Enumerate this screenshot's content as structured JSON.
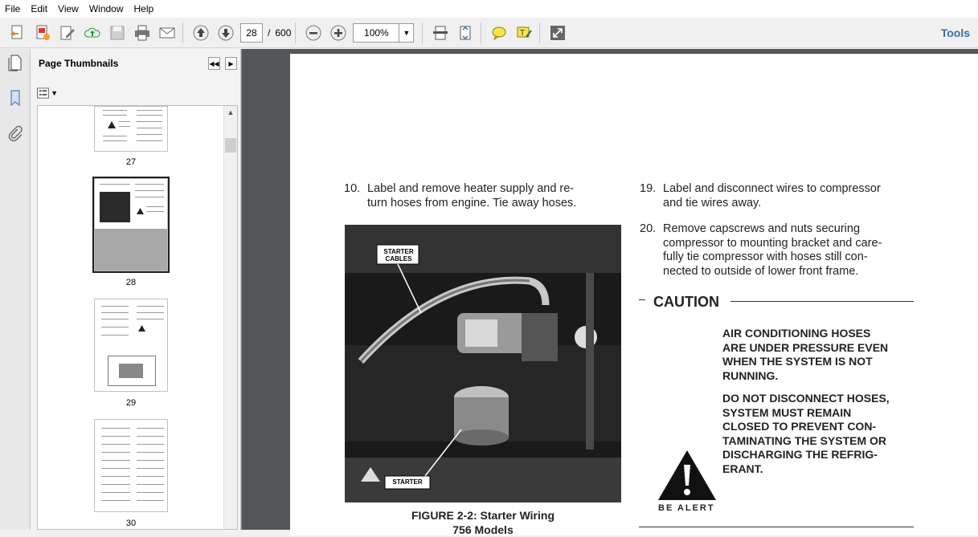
{
  "menu": [
    "File",
    "Edit",
    "View",
    "Window",
    "Help"
  ],
  "toolbar": {
    "current_page": "28",
    "page_separator": "/",
    "total_pages": "600",
    "zoom": "100%",
    "tools_label": "Tools"
  },
  "panel": {
    "title": "Page Thumbnails",
    "thumbnails": [
      {
        "label": "27"
      },
      {
        "label": "28"
      },
      {
        "label": "29"
      },
      {
        "label": "30"
      }
    ]
  },
  "document": {
    "item10_num": "10.",
    "item10_lines": [
      "Label and remove heater supply and re-",
      "turn hoses from engine.  Tie away hoses."
    ],
    "item19_num": "19.",
    "item19_lines": [
      "Label and disconnect wires to compressor",
      "and tie wires away."
    ],
    "item20_num": "20.",
    "item20_lines": [
      "Remove  capscrews  and  nuts  securing",
      "compressor to mounting bracket and care-",
      "fully tie compressor with hoses still con-",
      "nected to outside of lower front frame."
    ],
    "photo_label_1": [
      "STARTER",
      "CABLES"
    ],
    "photo_label_2": "STARTER",
    "figure_caption": [
      "FIGURE 2-2:  Starter Wiring",
      "756 Models"
    ],
    "caution_heading": "CAUTION",
    "warning_1": [
      "AIR  CONDITIONING  HOSES",
      "ARE UNDER PRESSURE EVEN",
      "WHEN  THE  SYSTEM  IS  NOT",
      "RUNNING."
    ],
    "warning_2": [
      "DO NOT DISCONNECT HOSES,",
      "SYSTEM      MUST      REMAIN",
      "CLOSED  TO  PREVENT  CON-",
      "TAMINATING THE SYSTEM OR",
      "DISCHARGING  THE  REFRIG-",
      "ERANT."
    ],
    "be_alert": "BE  ALERT"
  }
}
